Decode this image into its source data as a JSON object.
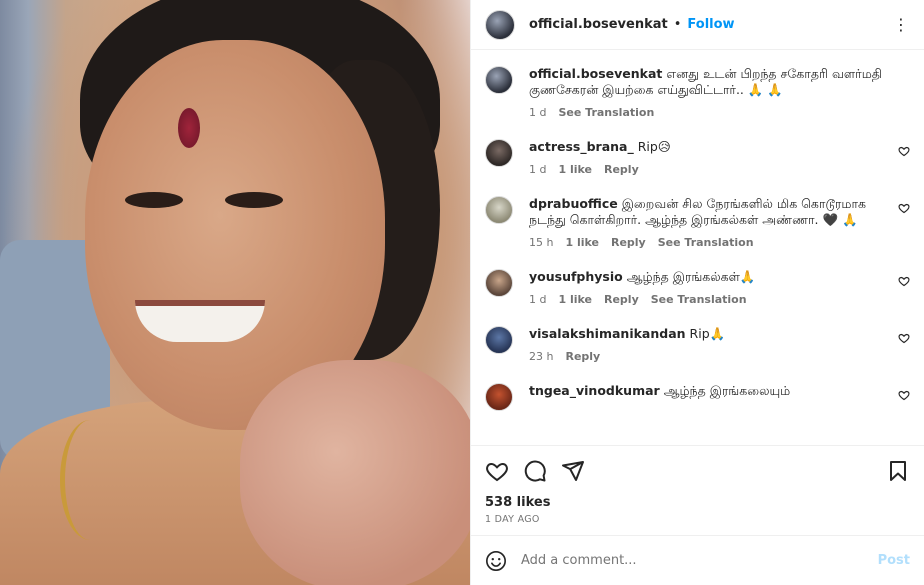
{
  "post": {
    "username": "official.bosevenkat",
    "follow_label": "Follow",
    "dot": "•",
    "more": "⋮",
    "likes": "538 likes",
    "time_ago": "1 DAY AGO"
  },
  "comments": [
    {
      "username": "official.bosevenkat",
      "text": "எனது உடன் பிறந்த சகோதரி வளர்மதி குணசேகரன் இயற்கை எய்துவிட்டார்.. 🙏 🙏",
      "time": "1 d",
      "likes": "",
      "reply": "",
      "translation": "See Translation"
    },
    {
      "username": "actress_brana_",
      "text": "Rip😥",
      "time": "1 d",
      "likes": "1 like",
      "reply": "Reply",
      "translation": ""
    },
    {
      "username": "dprabuoffice",
      "text": "இறைவன் சில நேரங்களில் மிக கொடூரமாக நடந்து கொள்கிறார். ஆழ்ந்த இரங்கல்கள் அண்ணா. 🖤 🙏",
      "time": "15 h",
      "likes": "1 like",
      "reply": "Reply",
      "translation": "See Translation"
    },
    {
      "username": "yousufphysio",
      "text": "ஆழ்ந்த இரங்கல்கள்🙏",
      "time": "1 d",
      "likes": "1 like",
      "reply": "Reply",
      "translation": "See Translation"
    },
    {
      "username": "visalakshimanikandan",
      "text": "Rip🙏",
      "time": "23 h",
      "likes": "",
      "reply": "Reply",
      "translation": ""
    },
    {
      "username": "tngea_vinodkumar",
      "text": "ஆழ்ந்த இரங்கலையும்",
      "time": "",
      "likes": "",
      "reply": "",
      "translation": ""
    }
  ],
  "add_comment": {
    "placeholder": "Add a comment...",
    "post_label": "Post"
  },
  "icons": [
    "heart-icon",
    "comment-icon",
    "share-icon",
    "bookmark-icon",
    "emoji-icon",
    "more-icon"
  ],
  "colors": {
    "accent": "#0095f6",
    "post_disabled": "#b2dffc",
    "muted": "#737373"
  }
}
